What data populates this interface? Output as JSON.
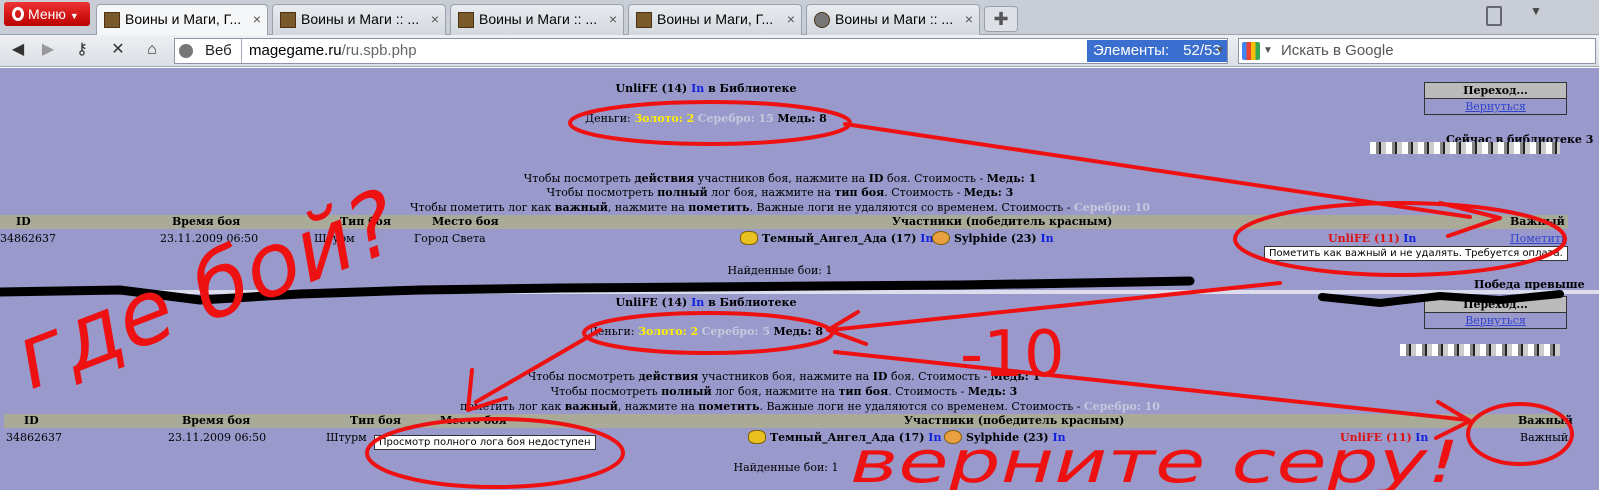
{
  "browser": {
    "menu_label": "Меню",
    "tabs": [
      {
        "title": "Воины и Маги, Г...",
        "active": true
      },
      {
        "title": "Воины и Маги :: ...",
        "active": false
      },
      {
        "title": "Воины и Маги :: ...",
        "active": false
      },
      {
        "title": "Воины и Маги, Г...",
        "active": false
      },
      {
        "title": "Воины и Маги :: ...",
        "active": false
      }
    ],
    "web_label": "Веб",
    "url_host": "magegame.ru",
    "url_path": "/ru.spb.php",
    "elements_label": "Элементы:",
    "elements_count": "52/53",
    "search_placeholder": "Искать в Google"
  },
  "top": {
    "title_name": "UnliFE (14)",
    "title_in": "In",
    "title_rest": "в Библиотеке",
    "money_label": "Деньги:",
    "gold": "Золото: 2",
    "silver": "Серебро: 15",
    "copper": "Медь: 8",
    "sidebar_title": "Переход...",
    "sidebar_link": "Вернуться",
    "side_text": "Сейчас в библиотеке 3",
    "info1_a": "Чтобы посмотреть",
    "info1_b": "действия",
    "info1_c": "участников боя, нажмите на",
    "info1_d": "ID",
    "info1_e": "боя. Стоимость -",
    "info1_f": "Медь: 1",
    "info2_a": "Чтобы посмотреть",
    "info2_b": "полный",
    "info2_c": "лог боя, нажмите на",
    "info2_d": "тип боя",
    "info2_e": ". Стоимость -",
    "info2_f": "Медь: 3",
    "info3_a": "Чтобы пометить лог как",
    "info3_b": "важный",
    "info3_c": ", нажмите на",
    "info3_d": "пометить",
    "info3_e": ". Важные логи не удаляются со временем. Стоимость -",
    "info3_f": "Серебро: 10",
    "headers": {
      "id": "ID",
      "time": "Время боя",
      "type": "Тип боя",
      "place": "Место боя",
      "participants": "Участники (победитель красным)",
      "important": "Важный"
    },
    "row": {
      "id": "34862637",
      "time": "23.11.2009 06:50",
      "type": "Штурм",
      "place": "Город Света",
      "p1": "Темный_Ангел_Ада (17)",
      "p2": "Sylphide (23)",
      "winner": "UnliFE (11)",
      "in": "In",
      "action": "Пометить"
    },
    "tooltip": "Пометить как важный и не удалять. Требуется оплата.",
    "found": "Найденные бои: 1",
    "side_text2": "Победа превыше"
  },
  "bottom": {
    "title_name": "UnliFE (14)",
    "title_in": "In",
    "title_rest": "в Библиотеке",
    "money_label": "Деньги:",
    "gold": "Золото: 2",
    "silver": "Серебро: 5",
    "copper": "Медь: 8",
    "sidebar_title": "Переход...",
    "sidebar_link": "Вернуться",
    "info1_a": "Чтобы посмотреть",
    "info1_b": "действия",
    "info1_c": "участников боя, нажмите на",
    "info1_d": "ID",
    "info1_e": "боя. Стоимость -",
    "info1_f": "Медь: 1",
    "info2_a": "Чтобы посмотреть",
    "info2_b": "полный",
    "info2_c": "лог боя, нажмите на",
    "info2_d": "тип боя",
    "info2_e": ". Стоимость -",
    "info2_f": "Медь: 3",
    "info3_a": "пометить лог как",
    "info3_b": "важный",
    "info3_c": ", нажмите на",
    "info3_d": "пометить",
    "info3_e": ". Важные логи не удаляются со временем. Стоимость -",
    "info3_f": "Серебро: 10",
    "headers": {
      "id": "ID",
      "time": "Время боя",
      "type": "Тип боя",
      "place": "Место боя",
      "participants": "Участники (победитель красным)",
      "important": "Важный"
    },
    "row": {
      "id": "34862637",
      "time": "23.11.2009 06:50",
      "type": "Штурм",
      "p1": "Темный_Ангел_Ада (17)",
      "p2": "Sylphide (23)",
      "winner": "UnliFE (11)",
      "in": "In",
      "action": "Важный"
    },
    "tooltip": "Просмотр полного лога боя недоступен",
    "found": "Найденные бои: 1"
  },
  "annotations": {
    "where_battle": "где бой?",
    "minus_ten": "-10",
    "return_silver": "верните серу!",
    "ink_color": "#ee1111"
  }
}
